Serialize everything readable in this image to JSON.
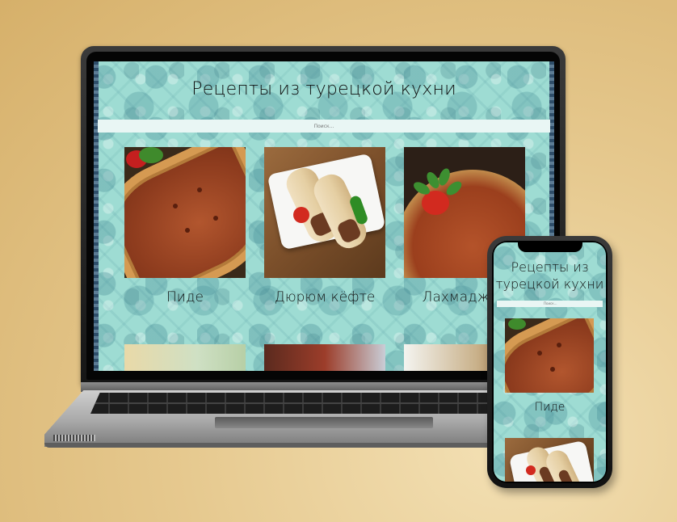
{
  "site": {
    "title": "Рецепты из турецкой кухни",
    "title_mobile_line1": "Рецепты из",
    "title_mobile_line2": "турецкой кухни",
    "search_placeholder": "Поиск...",
    "recipes": [
      {
        "name": "Пиде",
        "image": "pide-photo"
      },
      {
        "name": "Дюрюм кёфте",
        "image": "durum-kofte-photo"
      },
      {
        "name": "Лахмаджун",
        "image": "lahmacun-photo"
      }
    ]
  },
  "colors": {
    "page_background": "#9edcd3",
    "search_background": "#e9f6f4",
    "backdrop": "#e6c98f"
  },
  "devices": [
    "laptop",
    "phone"
  ]
}
